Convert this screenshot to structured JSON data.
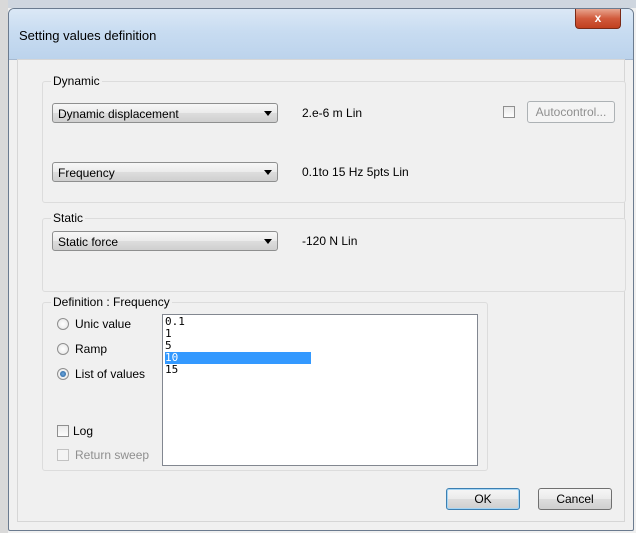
{
  "window": {
    "title": "Setting values definition",
    "close_label": "x"
  },
  "dynamic": {
    "group_label": "Dynamic",
    "type_select": {
      "value": "Dynamic displacement"
    },
    "type_value": "2.e-6  m Lin",
    "autocontrol": {
      "checked": false,
      "button_label": "Autocontrol..."
    },
    "freq_select": {
      "value": "Frequency"
    },
    "freq_value": "0.1to 15 Hz 5pts Lin"
  },
  "static": {
    "group_label": "Static",
    "type_select": {
      "value": "Static force"
    },
    "type_value": "-120  N Lin"
  },
  "definition": {
    "group_label": "Definition : Frequency",
    "options": [
      {
        "label": "Unic value",
        "checked": false
      },
      {
        "label": "Ramp",
        "checked": false
      },
      {
        "label": "List of values",
        "checked": true
      }
    ],
    "log": {
      "label": "Log",
      "checked": false
    },
    "return_sweep": {
      "label": "Return sweep",
      "checked": false,
      "enabled": false
    },
    "list": {
      "items": [
        "0.1",
        "1",
        "5",
        "10",
        "15"
      ],
      "selected_index": 3
    }
  },
  "buttons": {
    "ok": "OK",
    "cancel": "Cancel"
  },
  "colors": {
    "selection": "#3399ff",
    "title_bar": "#c8dcf1",
    "close_button": "#c1401f"
  }
}
